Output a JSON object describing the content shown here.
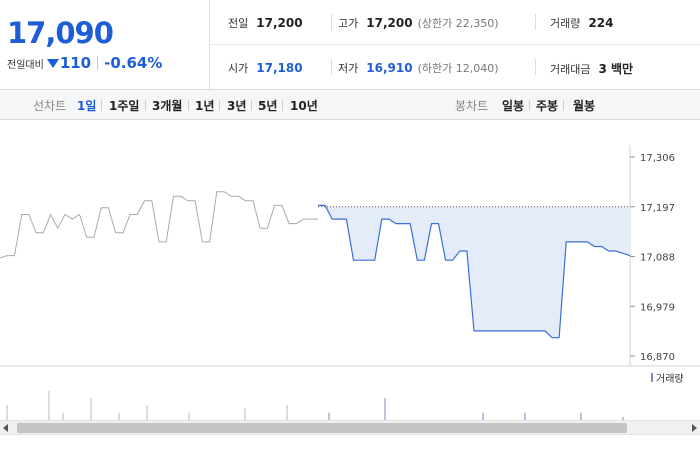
{
  "quote": {
    "price": "17,090",
    "change_label": "전일대비",
    "change_amount": "110",
    "change_percent": "-0.64%",
    "direction_icon": "triangle-down-icon"
  },
  "stats": {
    "prev_close": {
      "label": "전일",
      "value": "17,200"
    },
    "high": {
      "label": "고가",
      "value": "17,200",
      "sub": "(상한가 22,350)"
    },
    "volume": {
      "label": "거래량",
      "value": "224"
    },
    "open": {
      "label": "시가",
      "value": "17,180"
    },
    "low": {
      "label": "저가",
      "value": "16,910",
      "sub": "(하한가 12,040)"
    },
    "amount": {
      "label": "거래대금",
      "value": "3 백만"
    }
  },
  "tabs": {
    "line_label": "선차트",
    "line_tabs": [
      "1일",
      "1주일",
      "3개월",
      "1년",
      "3년",
      "5년",
      "10년"
    ],
    "active": "1일",
    "candle_label": "봉차트",
    "candle_tabs": [
      "일봉",
      "주봉",
      "월봉"
    ]
  },
  "colors": {
    "accent_blue": "#1d5ed8",
    "line_blue": "#3a6fd8",
    "fill_blue": "#e4ecfa",
    "prev_line_gray": "#aaaaaa"
  },
  "chart_data": {
    "type": "line",
    "yticks": [
      "17,306",
      "17,197",
      "17,088",
      "16,979",
      "16,870"
    ],
    "ylim": [
      16870,
      17306
    ],
    "reference_line": 17197,
    "volume_legend": "거래량",
    "series": [
      {
        "values": [
          17085,
          17090,
          17090,
          17180,
          17180,
          17140,
          17140,
          17180,
          17150,
          17180,
          17170,
          17180,
          17130,
          17130,
          17195,
          17195,
          17140,
          17140,
          17180,
          17180,
          17210,
          17210,
          17120,
          17120,
          17220,
          17220,
          17210,
          17210,
          17120,
          17120,
          17230,
          17230,
          17220,
          17220,
          17210,
          17210,
          17150,
          17150,
          17200,
          17200,
          17160,
          17160,
          17170,
          17170,
          17170
        ]
      },
      {
        "values": [
          17200,
          17200,
          17170,
          17170,
          17170,
          17080,
          17080,
          17080,
          17080,
          17170,
          17170,
          17160,
          17160,
          17160,
          17080,
          17080,
          17160,
          17160,
          17080,
          17080,
          17100,
          17100,
          16925,
          16925,
          16925,
          16925,
          16925,
          16925,
          16925,
          16925,
          16925,
          16925,
          16925,
          16910,
          16910,
          17120,
          17120,
          17120,
          17120,
          17110,
          17110,
          17100,
          17100,
          17095,
          17090
        ]
      }
    ],
    "volume_values": [
      0.1,
      0.0,
      0.0,
      0.2,
      0.05,
      0.0,
      0.15,
      0.0,
      0.05,
      0.0,
      0.1,
      0.0,
      0.0,
      0.05,
      0.0,
      0.0,
      0.0,
      0.08,
      0.0,
      0.0,
      0.1,
      0.0,
      0.0,
      0.05,
      0.0,
      0.0,
      0.0,
      0.15,
      0.0,
      0.0,
      0.0,
      0.0,
      0.0,
      0.0,
      0.05,
      0.0,
      0.0,
      0.05,
      0.0,
      0.0,
      0.0,
      0.05,
      0.0,
      0.0,
      0.02
    ]
  }
}
